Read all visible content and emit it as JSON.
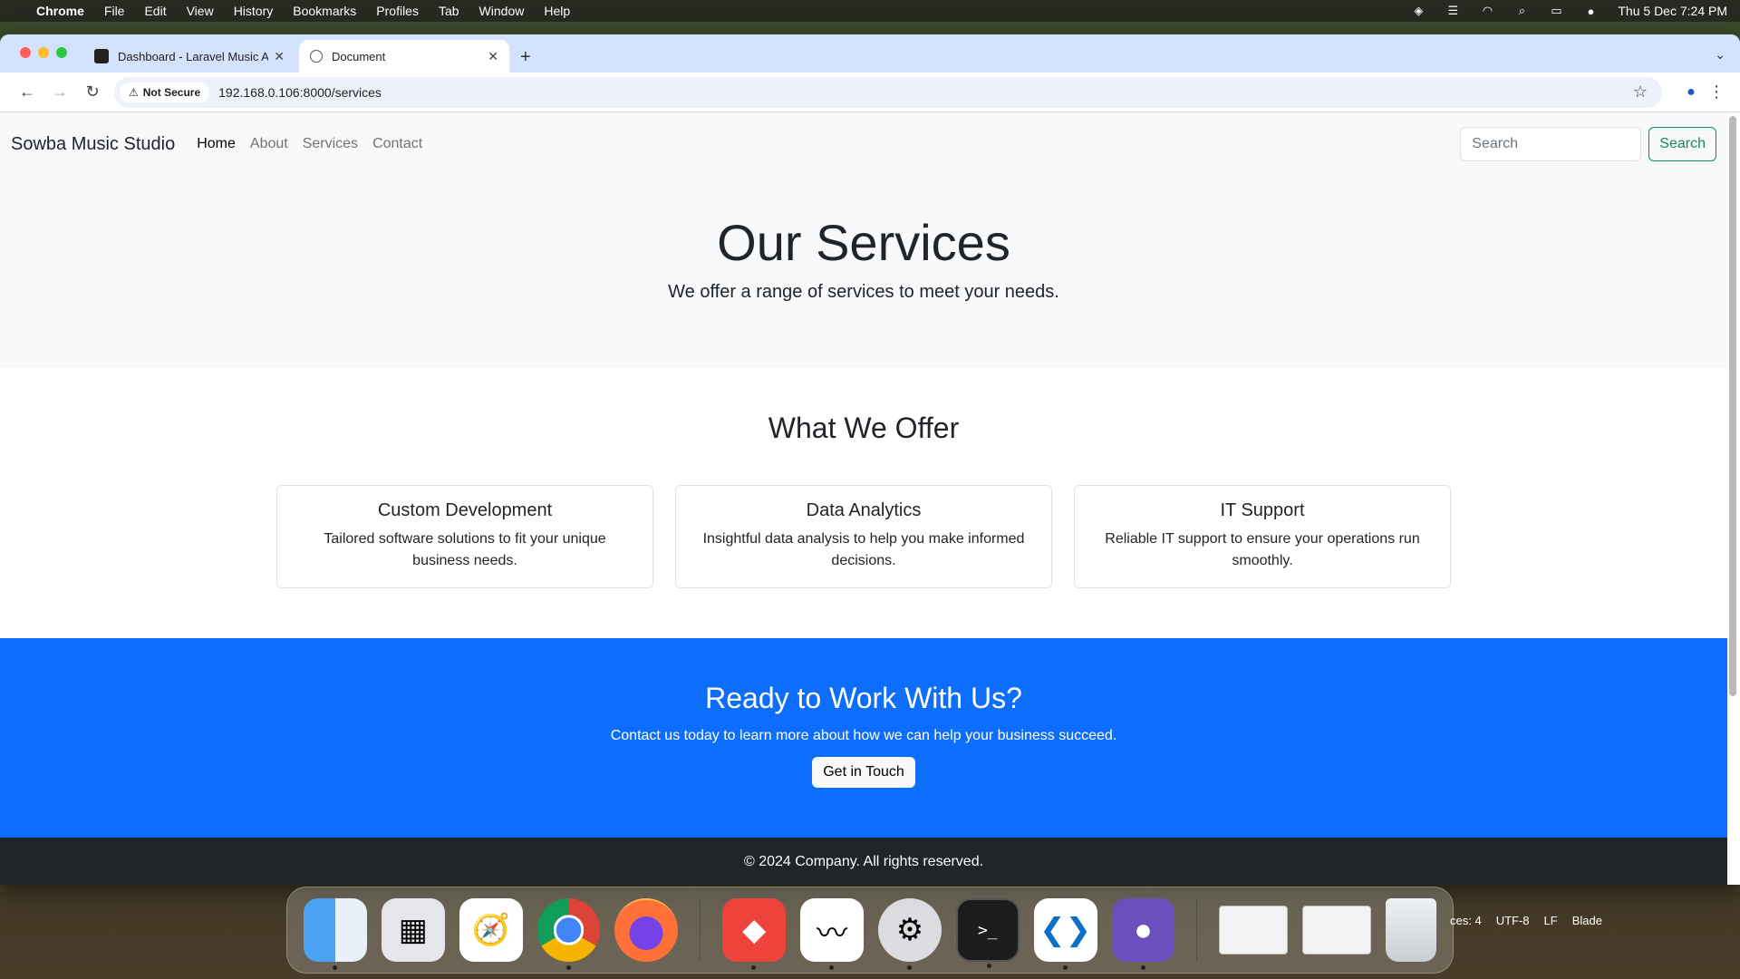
{
  "menubar": {
    "apple_icon": "apple-icon",
    "app_name": "Chrome",
    "items": [
      "File",
      "Edit",
      "View",
      "History",
      "Bookmarks",
      "Profiles",
      "Tab",
      "Window",
      "Help"
    ],
    "status_icons": [
      "dropbox-icon",
      "stack-icon",
      "wifi-icon",
      "search-icon",
      "control-center-icon",
      "siri-icon"
    ],
    "clock": "Thu 5 Dec  7:24 PM"
  },
  "browser": {
    "tabs": [
      {
        "title": "Dashboard - Laravel Music Ap",
        "active": false
      },
      {
        "title": "Document",
        "active": true
      }
    ],
    "new_tab_symbol": "+",
    "security_label": "Not Secure",
    "url": "192.168.0.106:8000/services"
  },
  "site": {
    "brand": "Sowba Music Studio",
    "nav": [
      {
        "label": "Home",
        "active": true
      },
      {
        "label": "About",
        "active": false
      },
      {
        "label": "Services",
        "active": false
      },
      {
        "label": "Contact",
        "active": false
      }
    ],
    "search_placeholder": "Search",
    "search_button": "Search",
    "hero": {
      "title": "Our Services",
      "subtitle": "We offer a range of services to meet your needs."
    },
    "offer": {
      "heading": "What We Offer",
      "cards": [
        {
          "title": "Custom Development",
          "text": "Tailored software solutions to fit your unique business needs."
        },
        {
          "title": "Data Analytics",
          "text": "Insightful data analysis to help you make informed decisions."
        },
        {
          "title": "IT Support",
          "text": "Reliable IT support to ensure your operations run smoothly."
        }
      ]
    },
    "cta": {
      "heading": "Ready to Work With Us?",
      "text": "Contact us today to learn more about how we can help your business succeed.",
      "button": "Get in Touch"
    },
    "footer": "© 2024 Company. All rights reserved."
  },
  "colors": {
    "primary": "#0d6efd",
    "success": "#198754",
    "dark": "#212529",
    "light": "#f8f9fa"
  },
  "dock": {
    "apps": [
      "finder-icon",
      "launchpad-icon",
      "safari-icon",
      "chrome-icon",
      "firefox-icon",
      "anydesk-icon",
      "freeform-icon",
      "system-settings-icon",
      "terminal-icon",
      "vscode-icon",
      "github-desktop-icon"
    ],
    "status_bar": [
      "ces: 4",
      "UTF-8",
      "LF",
      "Blade"
    ]
  }
}
